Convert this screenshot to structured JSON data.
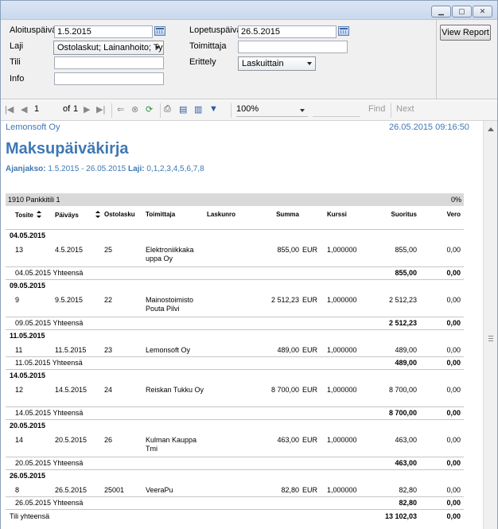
{
  "params": {
    "aloituspaiva_label": "Aloituspäivä",
    "aloituspaiva_value": "1.5.2015",
    "lopetuspaiva_label": "Lopetuspäivä",
    "lopetuspaiva_value": "26.5.2015",
    "laji_label": "Laji",
    "laji_value": "Ostolaskut; Lainanhoito; Työna",
    "toimittaja_label": "Toimittaja",
    "toimittaja_value": "",
    "tili_label": "Tili",
    "tili_value": "",
    "erittely_label": "Erittely",
    "erittely_value": "Laskuittain",
    "info_label": "Info",
    "info_value": "",
    "view_report": "View Report"
  },
  "toolbar": {
    "page": "1",
    "of_label": "of",
    "total_pages": "1",
    "zoom": "100%",
    "find": "Find",
    "next": "Next"
  },
  "report": {
    "company": "Lemonsoft Oy",
    "printed": "26.05.2015 09:16:50",
    "title": "Maksupäiväkirja",
    "period_label": "Ajanjakso:",
    "period_value": "1.5.2015 - 26.05.2015",
    "laji_label": "Laji:",
    "laji_value": "0,1,2,3,4,5,6,7,8",
    "account": "1910 Pankkitili 1",
    "account_pct": "0%",
    "columns": [
      "Tosite",
      "Päiväys",
      "Ostolasku",
      "Toimittaja",
      "Laskunro",
      "Summa",
      "Kurssi",
      "Suoritus",
      "Vero"
    ],
    "groups": [
      {
        "date": "04.05.2015",
        "rows": [
          {
            "tosite": "13",
            "paivays": "4.5.2015",
            "ostolasku": "25",
            "toimittaja": "Elektroniikkaka uppa Oy",
            "summa": "855,00",
            "valuutta": "EUR",
            "kurssi": "1,000000",
            "suoritus": "855,00",
            "vero": "0,00"
          }
        ],
        "total_label": "04.05.2015 Yhteensä",
        "total_suoritus": "855,00",
        "total_vero": "0,00"
      },
      {
        "date": "09.05.2015",
        "rows": [
          {
            "tosite": "9",
            "paivays": "9.5.2015",
            "ostolasku": "22",
            "toimittaja": "Mainostoimisto Pouta Pilvi",
            "summa": "2 512,23",
            "valuutta": "EUR",
            "kurssi": "1,000000",
            "suoritus": "2 512,23",
            "vero": "0,00"
          }
        ],
        "total_label": "09.05.2015 Yhteensä",
        "total_suoritus": "2 512,23",
        "total_vero": "0,00"
      },
      {
        "date": "11.05.2015",
        "rows": [
          {
            "tosite": "11",
            "paivays": "11.5.2015",
            "ostolasku": "23",
            "toimittaja": "Lemonsoft Oy",
            "summa": "489,00",
            "valuutta": "EUR",
            "kurssi": "1,000000",
            "suoritus": "489,00",
            "vero": "0,00"
          }
        ],
        "total_label": "11.05.2015 Yhteensä",
        "total_suoritus": "489,00",
        "total_vero": "0,00"
      },
      {
        "date": "14.05.2015",
        "rows": [
          {
            "tosite": "12",
            "paivays": "14.5.2015",
            "ostolasku": "24",
            "toimittaja": "Reiskan Tukku Oy",
            "summa": "8 700,00",
            "valuutta": "EUR",
            "kurssi": "1,000000",
            "suoritus": "8 700,00",
            "vero": "0,00"
          }
        ],
        "total_label": "14.05.2015 Yhteensä",
        "total_suoritus": "8 700,00",
        "total_vero": "0,00"
      },
      {
        "date": "20.05.2015",
        "rows": [
          {
            "tosite": "14",
            "paivays": "20.5.2015",
            "ostolasku": "26",
            "toimittaja": "Kulman Kauppa Tmi",
            "summa": "463,00",
            "valuutta": "EUR",
            "kurssi": "1,000000",
            "suoritus": "463,00",
            "vero": "0,00"
          }
        ],
        "total_label": "20.05.2015 Yhteensä",
        "total_suoritus": "463,00",
        "total_vero": "0,00"
      },
      {
        "date": "26.05.2015",
        "rows": [
          {
            "tosite": "8",
            "paivays": "26.5.2015",
            "ostolasku": "25001",
            "toimittaja": "VeeraPu",
            "summa": "82,80",
            "valuutta": "EUR",
            "kurssi": "1,000000",
            "suoritus": "82,80",
            "vero": "0,00"
          }
        ],
        "total_label": "26.05.2015 Yhteensä",
        "total_suoritus": "82,80",
        "total_vero": "0,00"
      }
    ],
    "grand_total_label": "Tili yhteensä",
    "grand_total_suoritus": "13 102,03",
    "grand_total_vero": "0,00"
  }
}
